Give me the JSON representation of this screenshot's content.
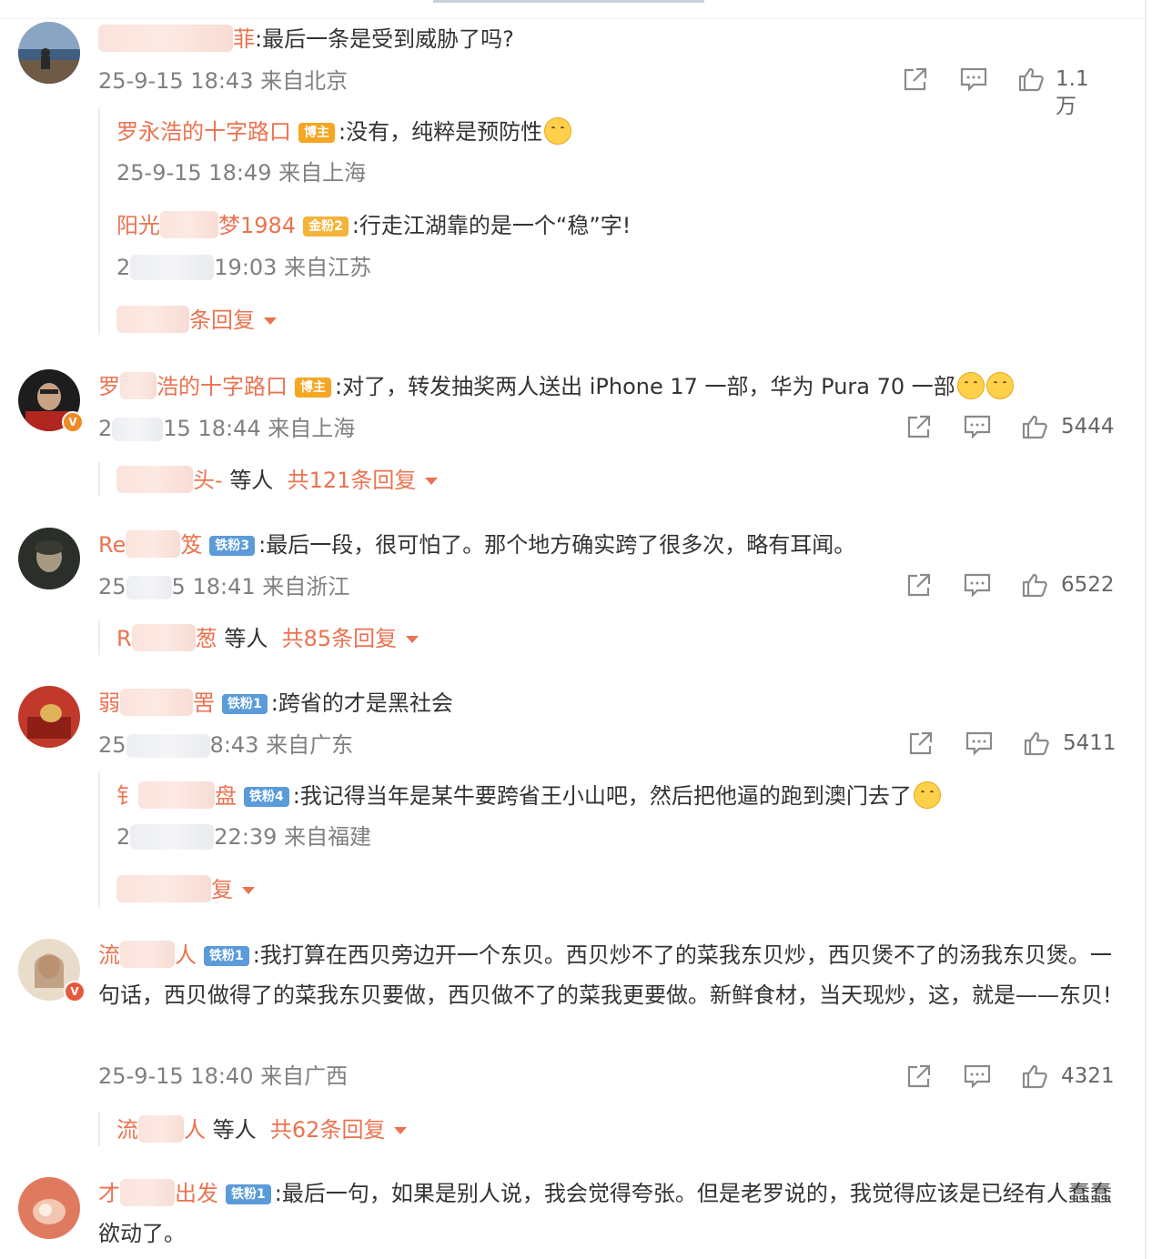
{
  "comments": [
    {
      "user_suffix": "菲",
      "text": ":最后一条是受到威胁了吗?",
      "time": "25-9-15 18:43",
      "location": "来自北京",
      "likes": "1.1万",
      "replies": [
        {
          "user": "罗永浩的十字路口",
          "tag": "博主",
          "text": ":没有，纯粹是预防性",
          "time": "25-9-15 18:49",
          "location": "来自上海"
        },
        {
          "user_prefix": "阳光",
          "user_suffix": "梦1984",
          "tag": "金粉2",
          "text": ":行走江湖靠的是一个“稳”字!",
          "time_prefix": "2",
          "time": "19:03",
          "location": "来自江苏"
        }
      ],
      "more_label": "条回复"
    },
    {
      "user_prefix": "罗",
      "user_suffix": "浩的十字路口",
      "tag": "博主",
      "text": ":对了，转发抽奖两人送出 iPhone 17 一部，华为 Pura 70 一部",
      "time_prefix": "2",
      "time": "15 18:44",
      "location": "来自上海",
      "likes": "5444",
      "more": {
        "user_suffix": "头-",
        "plain": "等人",
        "count": "共121条回复"
      }
    },
    {
      "user_prefix": "Re",
      "user_suffix": "笈",
      "tag": "铁粉3",
      "text": ":最后一段，很可怕了。那个地方确实跨了很多次，略有耳闻。",
      "time_prefix": "25",
      "time": "5 18:41",
      "location": "来自浙江",
      "likes": "6522",
      "more": {
        "user_prefix": "R",
        "user_suffix": "葱",
        "plain": "等人",
        "count": "共85条回复"
      }
    },
    {
      "user_prefix": "弱",
      "user_suffix": "罟",
      "tag": "铁粉1",
      "text": ":跨省的才是黑社会",
      "time_prefix": "25",
      "time": "8:43",
      "location": "来自广东",
      "likes": "5411",
      "replies": [
        {
          "user_prefix": "钅",
          "user_suffix": "盘",
          "tag": "铁粉4",
          "text": ":我记得当年是某牛要跨省王小山吧，然后把他逼的跑到澳门去了",
          "time_prefix": "2",
          "time": "22:39",
          "location": "来自福建"
        }
      ],
      "more_label": "复"
    },
    {
      "user_prefix": "流",
      "user_suffix": "人",
      "tag": "铁粉1",
      "text": ":我打算在西贝旁边开一个东贝。西贝炒不了的菜我东贝炒，西贝煲不了的汤我东贝煲。一句话，西贝做得了的菜我东贝要做，西贝做不了的菜我更要做。新鲜食材，当天现炒，这，就是——东贝!",
      "time": "25-9-15 18:40",
      "location": "来自广西",
      "likes": "4321",
      "more": {
        "user_prefix": "流",
        "user_suffix": "人",
        "plain": "等人",
        "count": "共62条回复"
      }
    },
    {
      "user_prefix": "才",
      "user_suffix": "出发",
      "tag": "铁粉1",
      "text": ":最后一句，如果是别人说，我会觉得夸张。但是老罗说的，我觉得应该是已经有人蠢蠢欲动了。"
    }
  ],
  "icons": {
    "share": "share-icon",
    "comment": "comment-icon",
    "like": "like-icon",
    "caret": "caret-down-icon"
  },
  "colors": {
    "username": "#eb7350",
    "meta": "#808080",
    "text": "#333333"
  }
}
